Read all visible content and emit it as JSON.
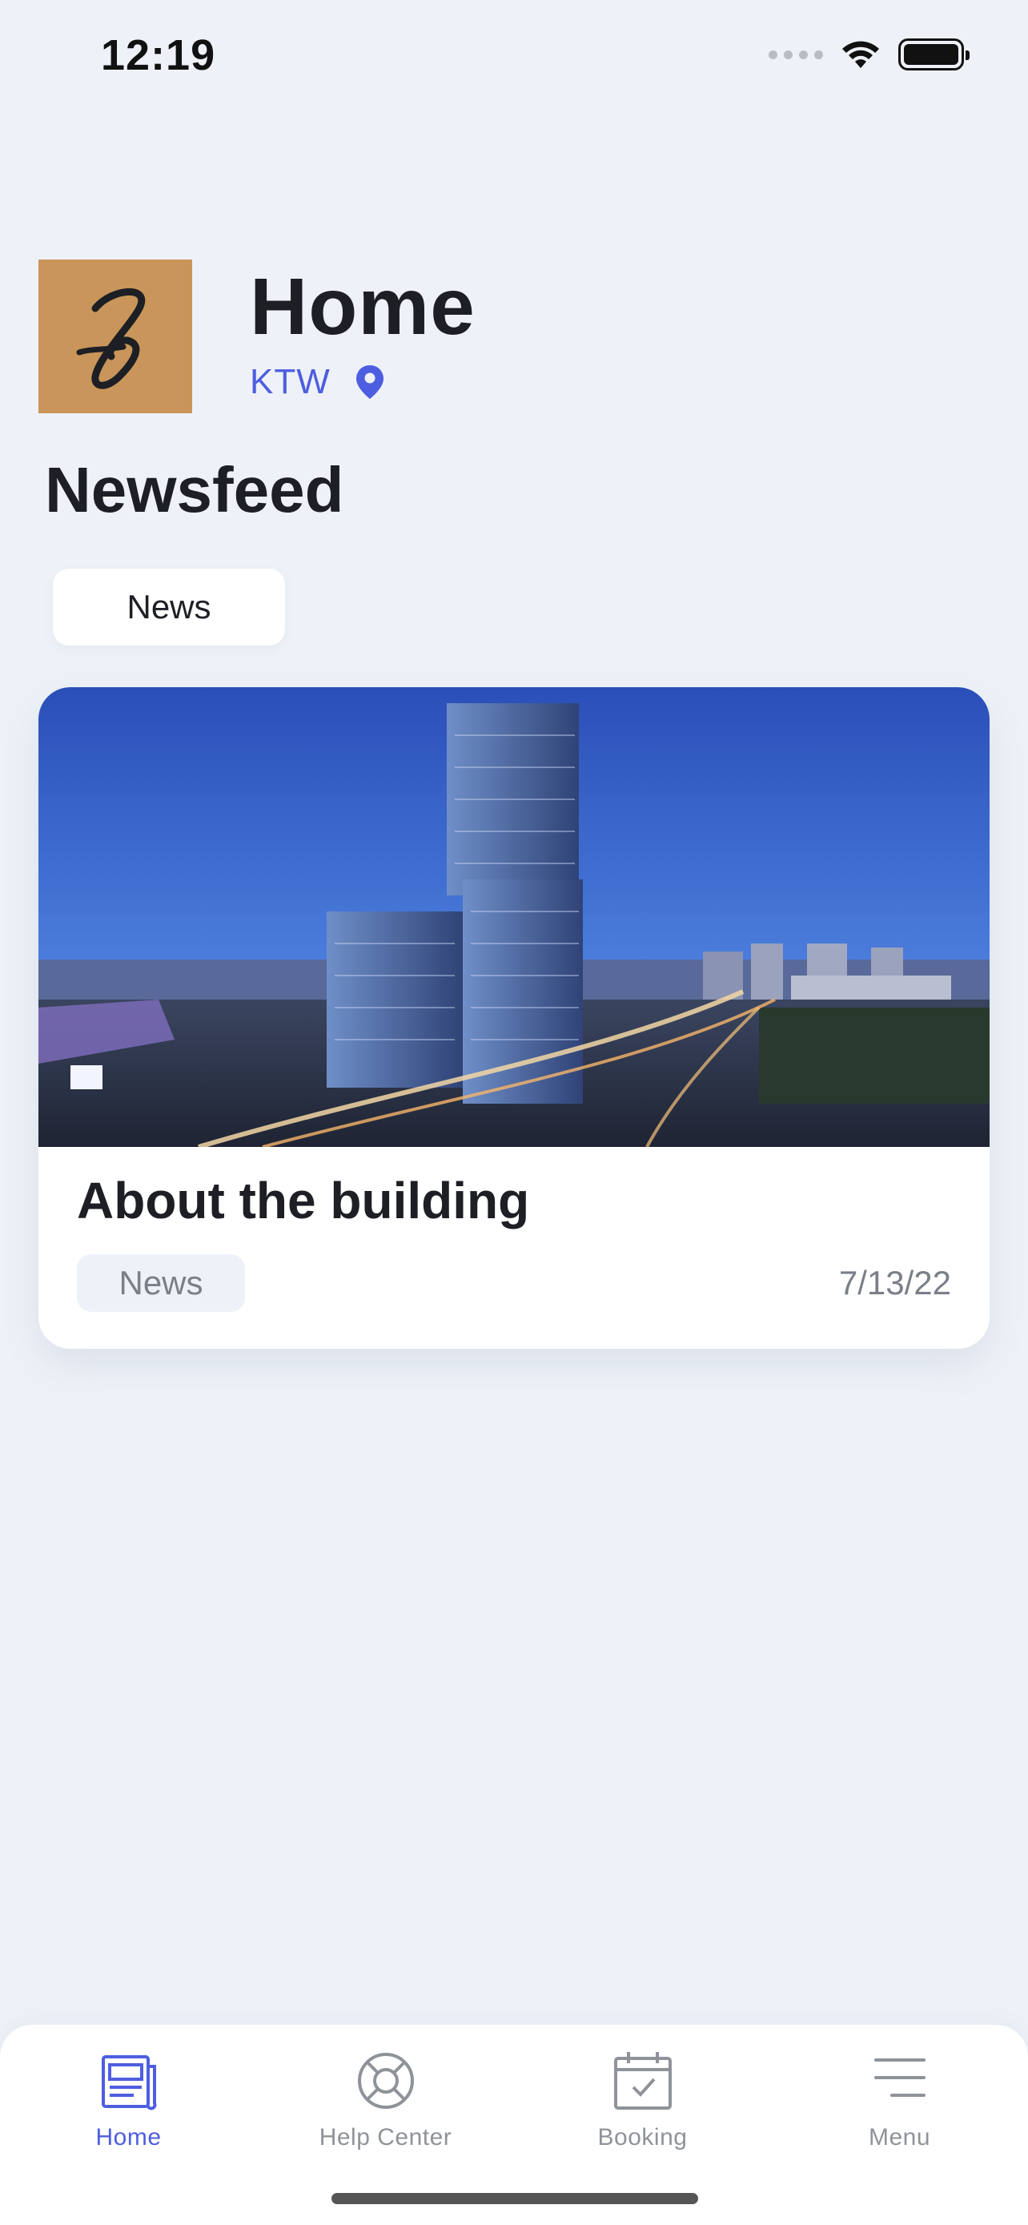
{
  "status_bar": {
    "time": "12:19"
  },
  "header": {
    "title": "Home",
    "location": "KTW",
    "logo_letter": "b"
  },
  "newsfeed": {
    "title": "Newsfeed",
    "filter_chip": "News",
    "items": [
      {
        "title": "About the building",
        "tag": "News",
        "date": "7/13/22"
      }
    ]
  },
  "tab_bar": {
    "tabs": [
      {
        "label": "Home",
        "icon": "newspaper-icon",
        "active": true
      },
      {
        "label": "Help Center",
        "icon": "lifebuoy-icon",
        "active": false
      },
      {
        "label": "Booking",
        "icon": "calendar-check-icon",
        "active": false
      },
      {
        "label": "Menu",
        "icon": "menu-icon",
        "active": false
      }
    ]
  },
  "colors": {
    "accent": "#4e5ee0",
    "background": "#eef2f8",
    "logo_bg": "#c9955a",
    "muted_text": "#7a7f88"
  }
}
